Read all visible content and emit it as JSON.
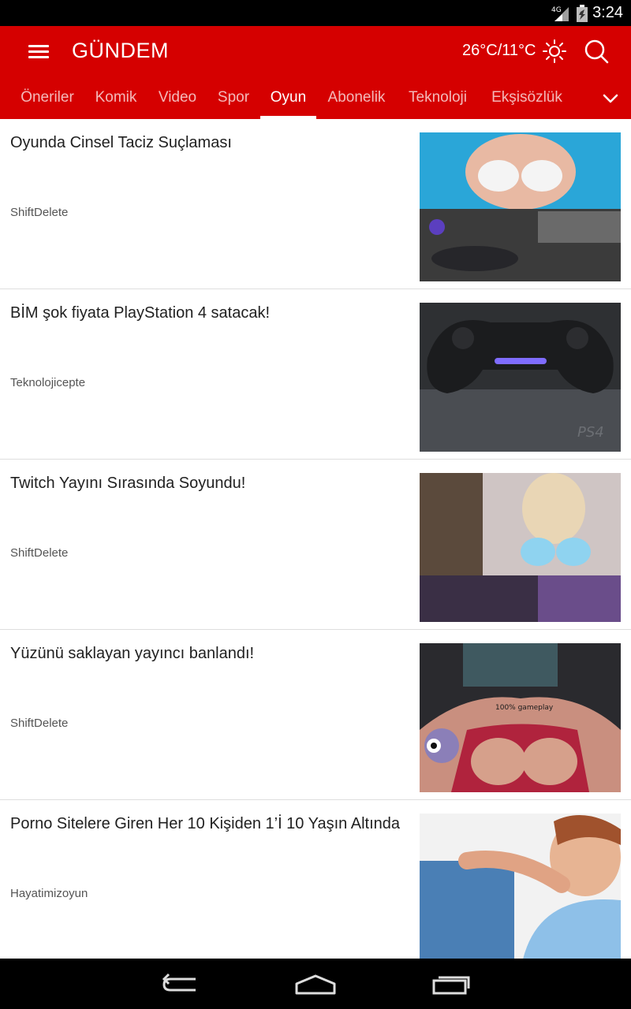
{
  "status": {
    "network": "4G",
    "time": "3:24"
  },
  "appbar": {
    "title": "GÜNDEM",
    "weather": "26°C/11°C",
    "accent": "#d50000"
  },
  "tabs": [
    {
      "label": "Öneriler"
    },
    {
      "label": "Komik"
    },
    {
      "label": "Video"
    },
    {
      "label": "Spor"
    },
    {
      "label": "Oyun",
      "active": true
    },
    {
      "label": "Abonelik"
    },
    {
      "label": "Teknoloji"
    },
    {
      "label": "Ekşisözlük"
    }
  ],
  "articles": [
    {
      "title": "Oyunda Cinsel Taciz Suçlaması",
      "source": "ShiftDelete"
    },
    {
      "title": "BİM şok fiyata PlayStation 4 satacak!",
      "source": "Teknolojicepte"
    },
    {
      "title": "Twitch Yayını Sırasında Soyundu!",
      "source": "ShiftDelete"
    },
    {
      "title": "Yüzünü saklayan yayıncı banlandı!",
      "source": "ShiftDelete"
    },
    {
      "title": "Porno Sitelere Giren Her 10 Kişiden 1’İ 10 Yaşın Altında",
      "source": "Hayatimizoyun"
    }
  ],
  "thumb_texts": {
    "ps4": "PS4",
    "gameplay": "100% gameplay"
  },
  "icons": [
    "menu-icon",
    "sun-icon",
    "search-icon",
    "chevron-down-icon",
    "back-icon",
    "home-icon",
    "recents-icon",
    "signal-icon",
    "battery-icon"
  ]
}
